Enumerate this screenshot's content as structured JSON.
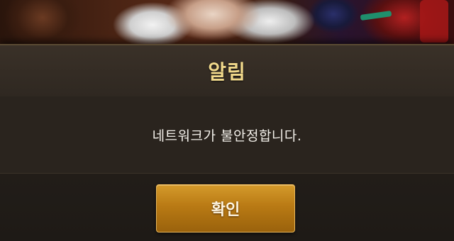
{
  "dialog": {
    "title": "알림",
    "message": "네트워크가 불안정합니다.",
    "confirm_label": "확인"
  },
  "colors": {
    "title_text": "#f1d98b",
    "message_text": "#f3f0ea",
    "button_fill": "#b97a14",
    "dialog_background": "#2a241e"
  }
}
